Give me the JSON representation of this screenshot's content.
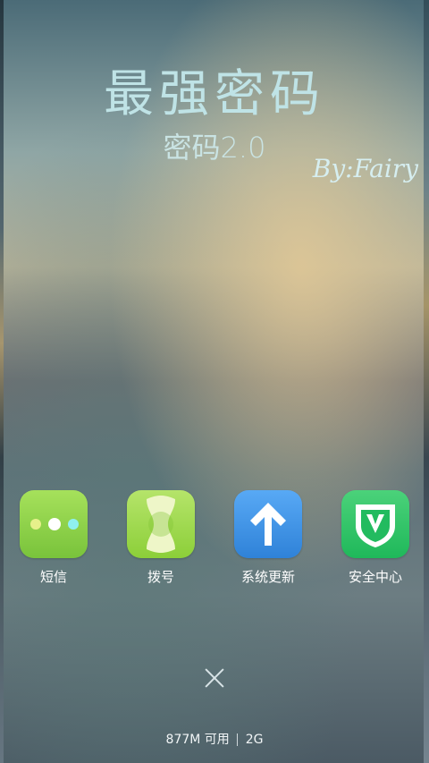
{
  "header": {
    "title": "最强密码",
    "subtitle": "密码2.0",
    "author": "By:Fairy"
  },
  "apps": [
    {
      "label": "短信",
      "icon": "message-icon",
      "color": "#8fd14a"
    },
    {
      "label": "拨号",
      "icon": "phone-dial-icon",
      "color": "#9ed64d"
    },
    {
      "label": "系统更新",
      "icon": "arrow-up-icon",
      "color": "#3b8fe4"
    },
    {
      "label": "安全中心",
      "icon": "shield-v-icon",
      "color": "#2cc063"
    }
  ],
  "footer": {
    "memory": "877M 可用",
    "total": "2G",
    "close_icon": "close-icon"
  }
}
